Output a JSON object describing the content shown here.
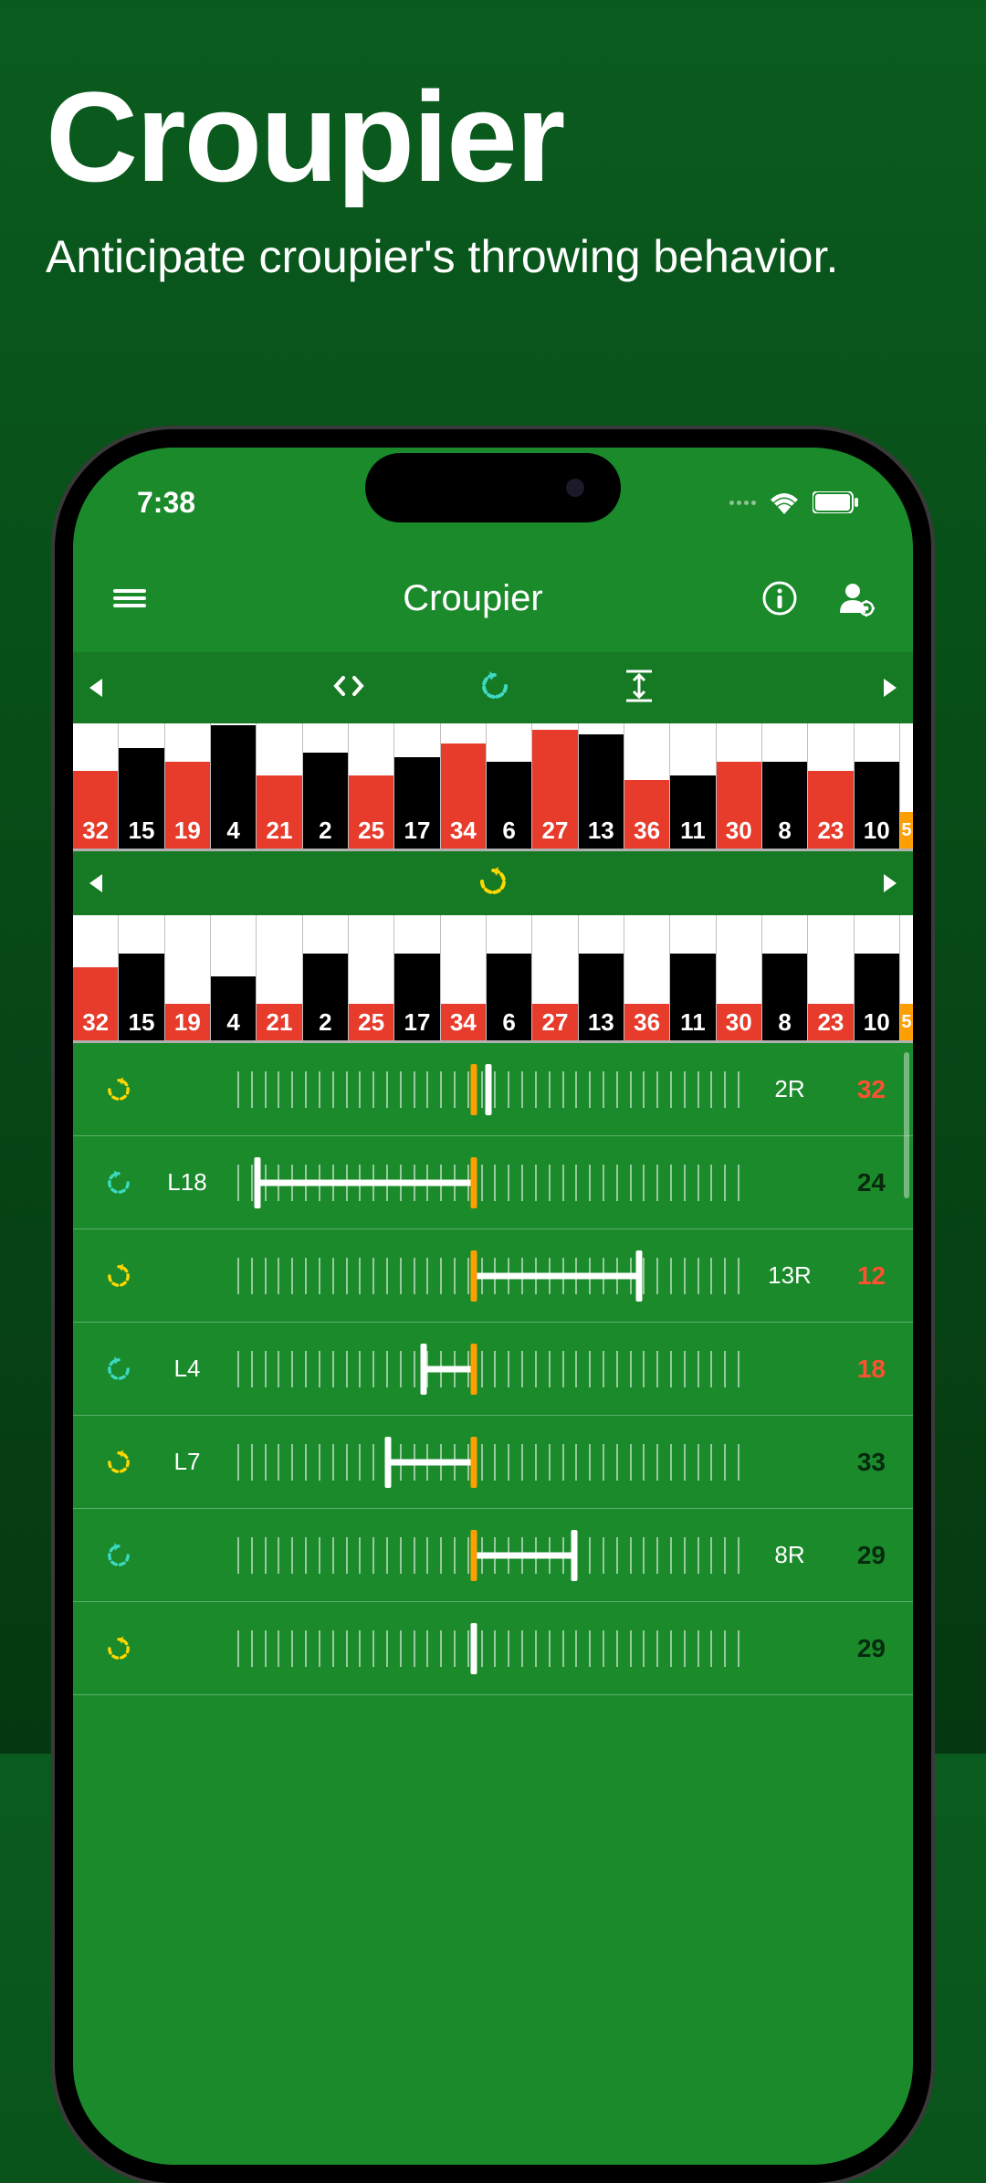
{
  "hero": {
    "title": "Croupier",
    "subtitle": "Anticipate croupier's throwing behavior."
  },
  "status": {
    "time": "7:38"
  },
  "header": {
    "title": "Croupier"
  },
  "wheel": {
    "cells": [
      {
        "n": "32",
        "c": "red",
        "h1": 45,
        "h2": 40
      },
      {
        "n": "15",
        "c": "black",
        "h1": 70,
        "h2": 55
      },
      {
        "n": "19",
        "c": "red",
        "h1": 55,
        "h2": 0
      },
      {
        "n": "4",
        "c": "black",
        "h1": 95,
        "h2": 30
      },
      {
        "n": "21",
        "c": "red",
        "h1": 40,
        "h2": 0
      },
      {
        "n": "2",
        "c": "black",
        "h1": 65,
        "h2": 55
      },
      {
        "n": "25",
        "c": "red",
        "h1": 40,
        "h2": 0
      },
      {
        "n": "17",
        "c": "black",
        "h1": 60,
        "h2": 55
      },
      {
        "n": "34",
        "c": "red",
        "h1": 75,
        "h2": 0
      },
      {
        "n": "6",
        "c": "black",
        "h1": 55,
        "h2": 55
      },
      {
        "n": "27",
        "c": "red",
        "h1": 90,
        "h2": 0
      },
      {
        "n": "13",
        "c": "black",
        "h1": 85,
        "h2": 55
      },
      {
        "n": "36",
        "c": "red",
        "h1": 35,
        "h2": 0
      },
      {
        "n": "11",
        "c": "black",
        "h1": 40,
        "h2": 55
      },
      {
        "n": "30",
        "c": "red",
        "h1": 55,
        "h2": 0
      },
      {
        "n": "8",
        "c": "black",
        "h1": 55,
        "h2": 55
      },
      {
        "n": "23",
        "c": "red",
        "h1": 45,
        "h2": 0
      },
      {
        "n": "10",
        "c": "black",
        "h1": 55,
        "h2": 55
      }
    ],
    "edge": "5"
  },
  "rows": [
    {
      "dir": "cw",
      "dirColor": "yellow",
      "left": "",
      "right": "2R",
      "val": "32",
      "valColor": "red",
      "mOrange": 47,
      "mWhite": 50
    },
    {
      "dir": "ccw",
      "dirColor": "teal",
      "left": "L18",
      "right": "",
      "val": "24",
      "valColor": "black",
      "mOrange": 47,
      "mWhite": 4,
      "conn": [
        4,
        47
      ]
    },
    {
      "dir": "cw",
      "dirColor": "yellow",
      "left": "",
      "right": "13R",
      "val": "12",
      "valColor": "red",
      "mOrange": 47,
      "mWhite": 80,
      "conn": [
        47,
        80
      ]
    },
    {
      "dir": "ccw",
      "dirColor": "teal",
      "left": "L4",
      "right": "",
      "val": "18",
      "valColor": "red",
      "mOrange": 47,
      "mWhite": 37,
      "conn": [
        37,
        47
      ]
    },
    {
      "dir": "cw",
      "dirColor": "yellow",
      "left": "L7",
      "right": "",
      "val": "33",
      "valColor": "black",
      "mOrange": 47,
      "mWhite": 30,
      "conn": [
        30,
        47
      ]
    },
    {
      "dir": "ccw",
      "dirColor": "teal",
      "left": "",
      "right": "8R",
      "val": "29",
      "valColor": "black",
      "mOrange": 47,
      "mWhite": 67,
      "conn": [
        47,
        67
      ]
    },
    {
      "dir": "cw",
      "dirColor": "yellow",
      "left": "",
      "right": "",
      "val": "29",
      "valColor": "black",
      "mOrange": 47,
      "mWhite": 47
    }
  ]
}
